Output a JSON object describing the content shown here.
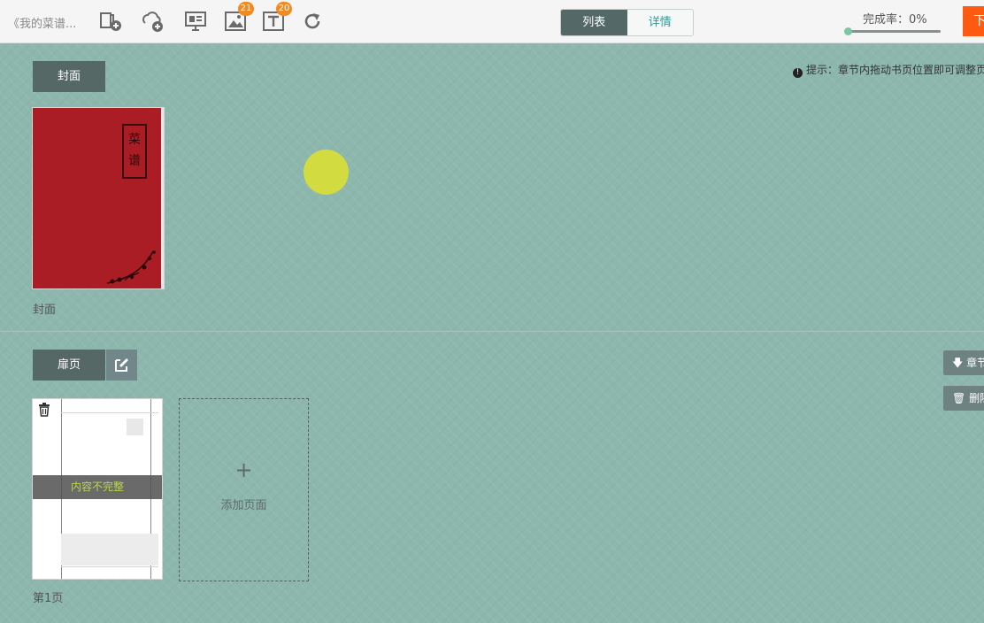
{
  "toolbar": {
    "book_title": "《我的菜谱...",
    "tools": [
      {
        "icon": "add-page-icon"
      },
      {
        "icon": "add-cloud-icon"
      },
      {
        "icon": "present-icon"
      },
      {
        "icon": "image-icon",
        "badge": "21"
      },
      {
        "icon": "text-icon",
        "badge": "20"
      },
      {
        "icon": "refresh-icon"
      }
    ],
    "view_list": "列表",
    "view_detail": "详情",
    "progress_label": "完成率：0%",
    "progress_value": 0,
    "download_label": "下载"
  },
  "hint": {
    "icon": "!",
    "text": "提示：章节内拖动书页位置即可调整页"
  },
  "cover_section": {
    "tag": "封面",
    "cover_title": "菜谱",
    "caption": "封面"
  },
  "title_section": {
    "tag": "扉页",
    "chapter_button": "章节",
    "delete_button": "删除",
    "page_caption": "第1页",
    "incomplete_label": "内容不完整",
    "add_plus": "+",
    "add_label": "添加页面"
  },
  "colors": {
    "background": "#8db7ad",
    "accent_orange": "#ff5a12",
    "tag_dark": "#556866",
    "cover_red": "#aa1d25",
    "incomplete_text": "#b9d84c",
    "highlight_dot": "#d8de37"
  }
}
